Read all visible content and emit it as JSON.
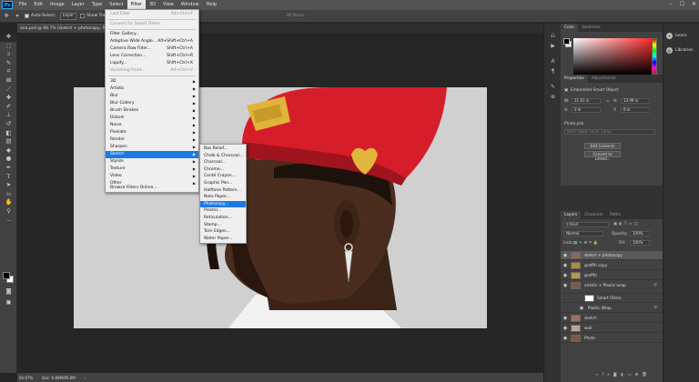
{
  "menubar": {
    "logo": "Ps",
    "items": [
      "File",
      "Edit",
      "Image",
      "Layer",
      "Type",
      "Select",
      "Filter",
      "3D",
      "View",
      "Window",
      "Help"
    ],
    "active_index": 6
  },
  "options": {
    "auto_select_label": "Auto-Select:",
    "auto_select_value": "Layer",
    "show_transform_label": "Show Tran",
    "mode_3d_label": "3D Mode:"
  },
  "document": {
    "tab_label": "ana.psd @ 66.7% (sketch + photocopy, RGB/8)"
  },
  "status": {
    "zoom": "66.67%",
    "doc_info": "Doc: 6.86M/95.0M"
  },
  "filter_menu": {
    "items": [
      {
        "label": "Last Filter",
        "shortcut": "Alt+Ctrl+F",
        "disabled": true
      },
      {
        "label": "Convert for Smart Filters",
        "disabled": true
      },
      {
        "label": "Filter Gallery..."
      },
      {
        "label": "Adaptive Wide Angle...",
        "shortcut": "Alt+Shift+Ctrl+A"
      },
      {
        "label": "Camera Raw Filter...",
        "shortcut": "Shift+Ctrl+A"
      },
      {
        "label": "Lens Correction...",
        "shortcut": "Shift+Ctrl+R"
      },
      {
        "label": "Liquify...",
        "shortcut": "Shift+Ctrl+X"
      },
      {
        "label": "Vanishing Point...",
        "shortcut": "Alt+Ctrl+V",
        "disabled": true
      },
      {
        "label": "3D",
        "submenu": true
      },
      {
        "label": "Artistic",
        "submenu": true
      },
      {
        "label": "Blur",
        "submenu": true
      },
      {
        "label": "Blur Gallery",
        "submenu": true
      },
      {
        "label": "Brush Strokes",
        "submenu": true
      },
      {
        "label": "Distort",
        "submenu": true
      },
      {
        "label": "Noise",
        "submenu": true
      },
      {
        "label": "Pixelate",
        "submenu": true
      },
      {
        "label": "Render",
        "submenu": true
      },
      {
        "label": "Sharpen",
        "submenu": true
      },
      {
        "label": "Sketch",
        "submenu": true,
        "highlight": true
      },
      {
        "label": "Stylize",
        "submenu": true
      },
      {
        "label": "Texture",
        "submenu": true
      },
      {
        "label": "Video",
        "submenu": true
      },
      {
        "label": "Other",
        "submenu": true
      },
      {
        "label": "Browse Filters Online..."
      }
    ]
  },
  "sketch_menu": {
    "items": [
      "Bas Relief...",
      "Chalk & Charcoal...",
      "Charcoal...",
      "Chrome...",
      "Conté Crayon...",
      "Graphic Pen...",
      "Halftone Pattern...",
      "Note Paper...",
      "Photocopy...",
      "Plaster...",
      "Reticulation...",
      "Stamp...",
      "Torn Edges...",
      "Water Paper..."
    ],
    "highlight_index": 8
  },
  "color_panel": {
    "tabs": [
      "Color",
      "Swatches"
    ]
  },
  "properties_panel": {
    "tabs": [
      "Properties",
      "Adjustments"
    ],
    "object_type": "Embedded Smart Object",
    "w_label": "W:",
    "w_value": "21.61 in",
    "h_label": "H:",
    "h_value": "13.99 in",
    "x_label": "X:",
    "x_value": "0 in",
    "y_label": "Y:",
    "y_value": "0 in",
    "file_name": "Photo.psb",
    "comp_placeholder": "Don't Apply Layer Comp",
    "edit_button": "Edit Contents",
    "convert_button": "Convert to Linked..."
  },
  "layers_panel": {
    "tabs": [
      "Layers",
      "Channels",
      "Paths"
    ],
    "kind_label": "Kind",
    "blend_mode": "Normal",
    "opacity_label": "Opacity:",
    "opacity_value": "100%",
    "lock_label": "Lock:",
    "fill_label": "Fill:",
    "fill_value": "100%",
    "layers": [
      {
        "name": "sketch + photocopy",
        "selected": true,
        "thumb": "#8a6a5a"
      },
      {
        "name": "graffiti copy",
        "thumb": "#b58a3a"
      },
      {
        "name": "graffiti",
        "thumb": "#c09440"
      },
      {
        "name": "artistic + Plastic wrap",
        "thumb": "#7a5a4a",
        "badge": "◎"
      },
      {
        "name": "Smart Filters",
        "sub": true,
        "thumb": "#ffffff"
      },
      {
        "name": "Plastic Wrap",
        "sub": true,
        "thumb": "",
        "badge": "≡"
      },
      {
        "name": "sketch",
        "thumb": "#9a7060"
      },
      {
        "name": "wall",
        "thumb": "#b0a898"
      },
      {
        "name": "Photo",
        "thumb": "#7a5a4a"
      }
    ]
  },
  "right_strip": {
    "learn_label": "Learn",
    "libraries_label": "Libraries"
  }
}
